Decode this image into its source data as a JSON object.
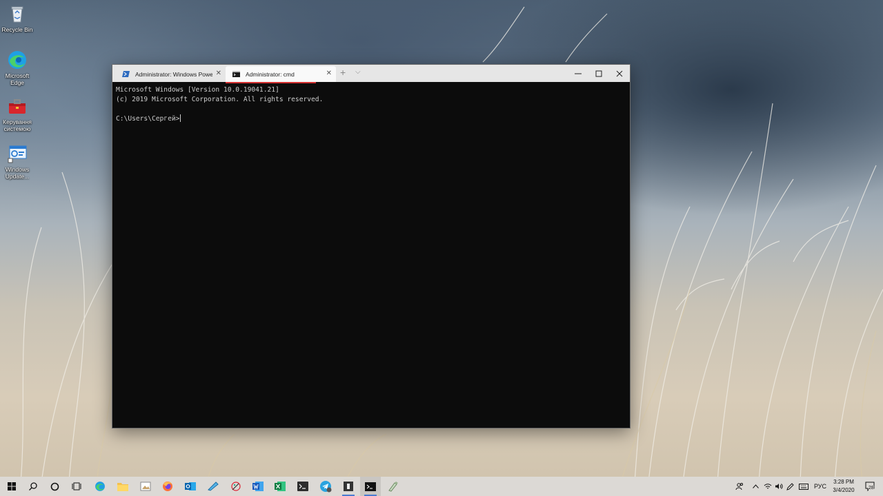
{
  "desktop": {
    "icons": [
      {
        "label": "Recycle Bin",
        "icon": "recycle-bin-icon"
      },
      {
        "label": "Microsoft Edge",
        "icon": "edge-icon"
      },
      {
        "label": "Керування системою",
        "icon": "toolbox-icon"
      },
      {
        "label": "Windows Update...",
        "icon": "windows-update-icon"
      }
    ]
  },
  "terminal": {
    "tabs": [
      {
        "label": "Administrator: Windows PowerS",
        "icon": "powershell-icon",
        "active": false
      },
      {
        "label": "Administrator: cmd",
        "icon": "cmd-icon",
        "active": true
      }
    ],
    "new_tab": "+",
    "dropdown": "⌵",
    "controls": {
      "minimize": "—",
      "maximize": "☐",
      "close": "✕"
    },
    "output": [
      "Microsoft Windows [Version 10.0.19041.21]",
      "(c) 2019 Microsoft Corporation. All rights reserved.",
      "",
      "C:\\Users\\Сергей>"
    ]
  },
  "taskbar": {
    "apps": [
      "start-icon",
      "search-icon",
      "cortana-icon",
      "task-view-icon",
      "edge-icon",
      "file-explorer-icon",
      "photos-icon",
      "firefox-icon",
      "outlook-icon",
      "snip-icon",
      "paint-icon",
      "word-icon",
      "excel-icon",
      "terminal-app-icon",
      "telegram-icon",
      "notes-icon",
      "cmd-icon",
      "tool-icon"
    ],
    "tray": {
      "language": "РУС",
      "time": "3:28 PM",
      "date": "3/4/2020",
      "notifications": "28"
    }
  }
}
